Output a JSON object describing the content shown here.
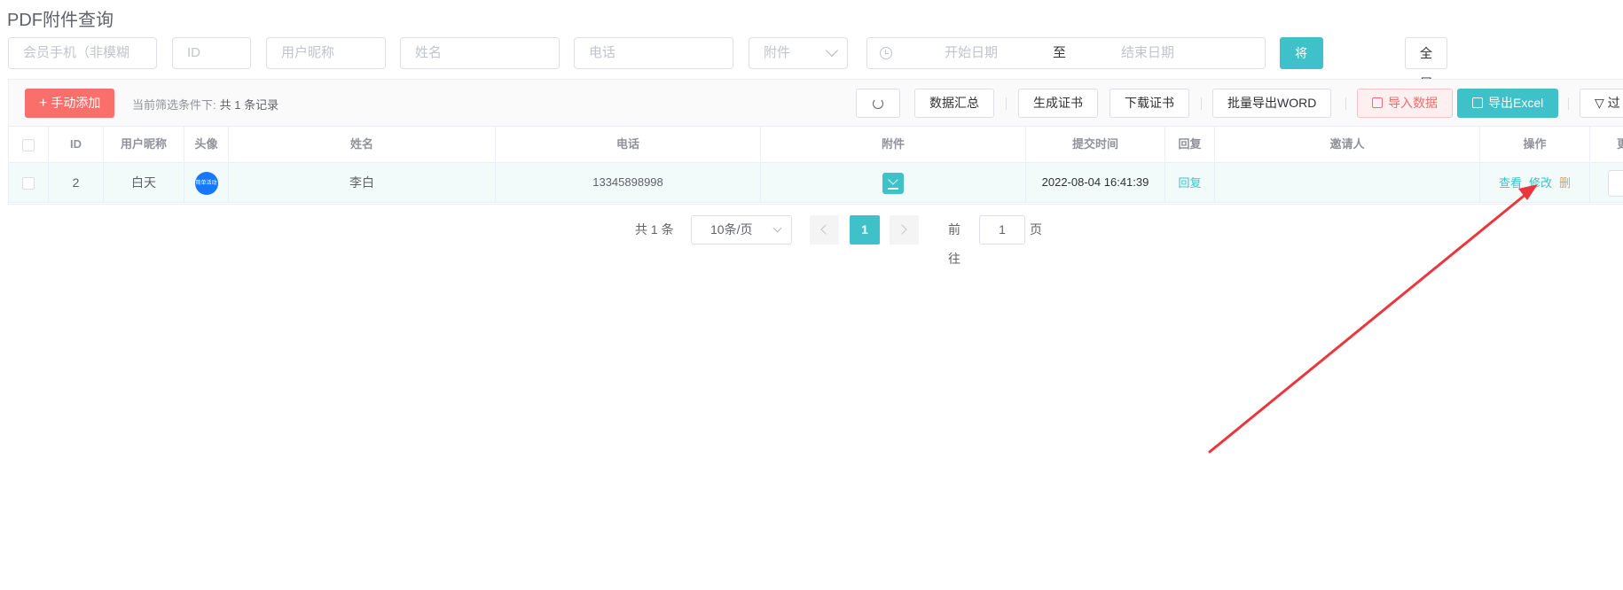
{
  "page": {
    "title": "PDF附件查询"
  },
  "filters": {
    "member_phone_placeholder": "会员手机（非模糊",
    "id_placeholder": "ID",
    "nickname_placeholder": "用户昵称",
    "name_placeholder": "姓名",
    "phone_placeholder": "电话",
    "attachment_placeholder": "附件",
    "date_start_placeholder": "开始日期",
    "date_separator": "至",
    "date_end_placeholder": "结束日期",
    "group_button": "将用户分组为",
    "fullscreen_button": "全屏"
  },
  "toolbar": {
    "add_button": "手动添加",
    "add_icon": "+",
    "filter_label": "当前筛选条件下:",
    "filter_count": "共 1 条记录",
    "summary_button": "数据汇总",
    "generate_cert_button": "生成证书",
    "download_cert_button": "下载证书",
    "export_word_button": "批量导出WORD",
    "import_button": "导入数据",
    "export_excel_button": "导出Excel",
    "filter_button": "过"
  },
  "table": {
    "headers": {
      "id": "ID",
      "nickname": "用户昵称",
      "avatar": "头像",
      "name": "姓名",
      "phone": "电话",
      "attachment": "附件",
      "submit_time": "提交时间",
      "reply": "回复",
      "inviter": "邀请人",
      "actions": "操作",
      "extra": "更"
    },
    "rows": [
      {
        "id": "2",
        "nickname": "白天",
        "avatar_text": "简单活动",
        "name": "李白",
        "phone": "13345898998",
        "submit_time": "2022-08-04 16:41:39",
        "reply": "回复",
        "inviter": "",
        "action_view": "查看",
        "action_edit": "修改",
        "action_delete": "删"
      }
    ]
  },
  "pagination": {
    "total": "共 1 条",
    "page_size": "10条/页",
    "current_page": "1",
    "goto_label": "前往",
    "goto_value": "1",
    "page_suffix": "页"
  },
  "annotation": {
    "arrow_color": "#e8383d"
  }
}
